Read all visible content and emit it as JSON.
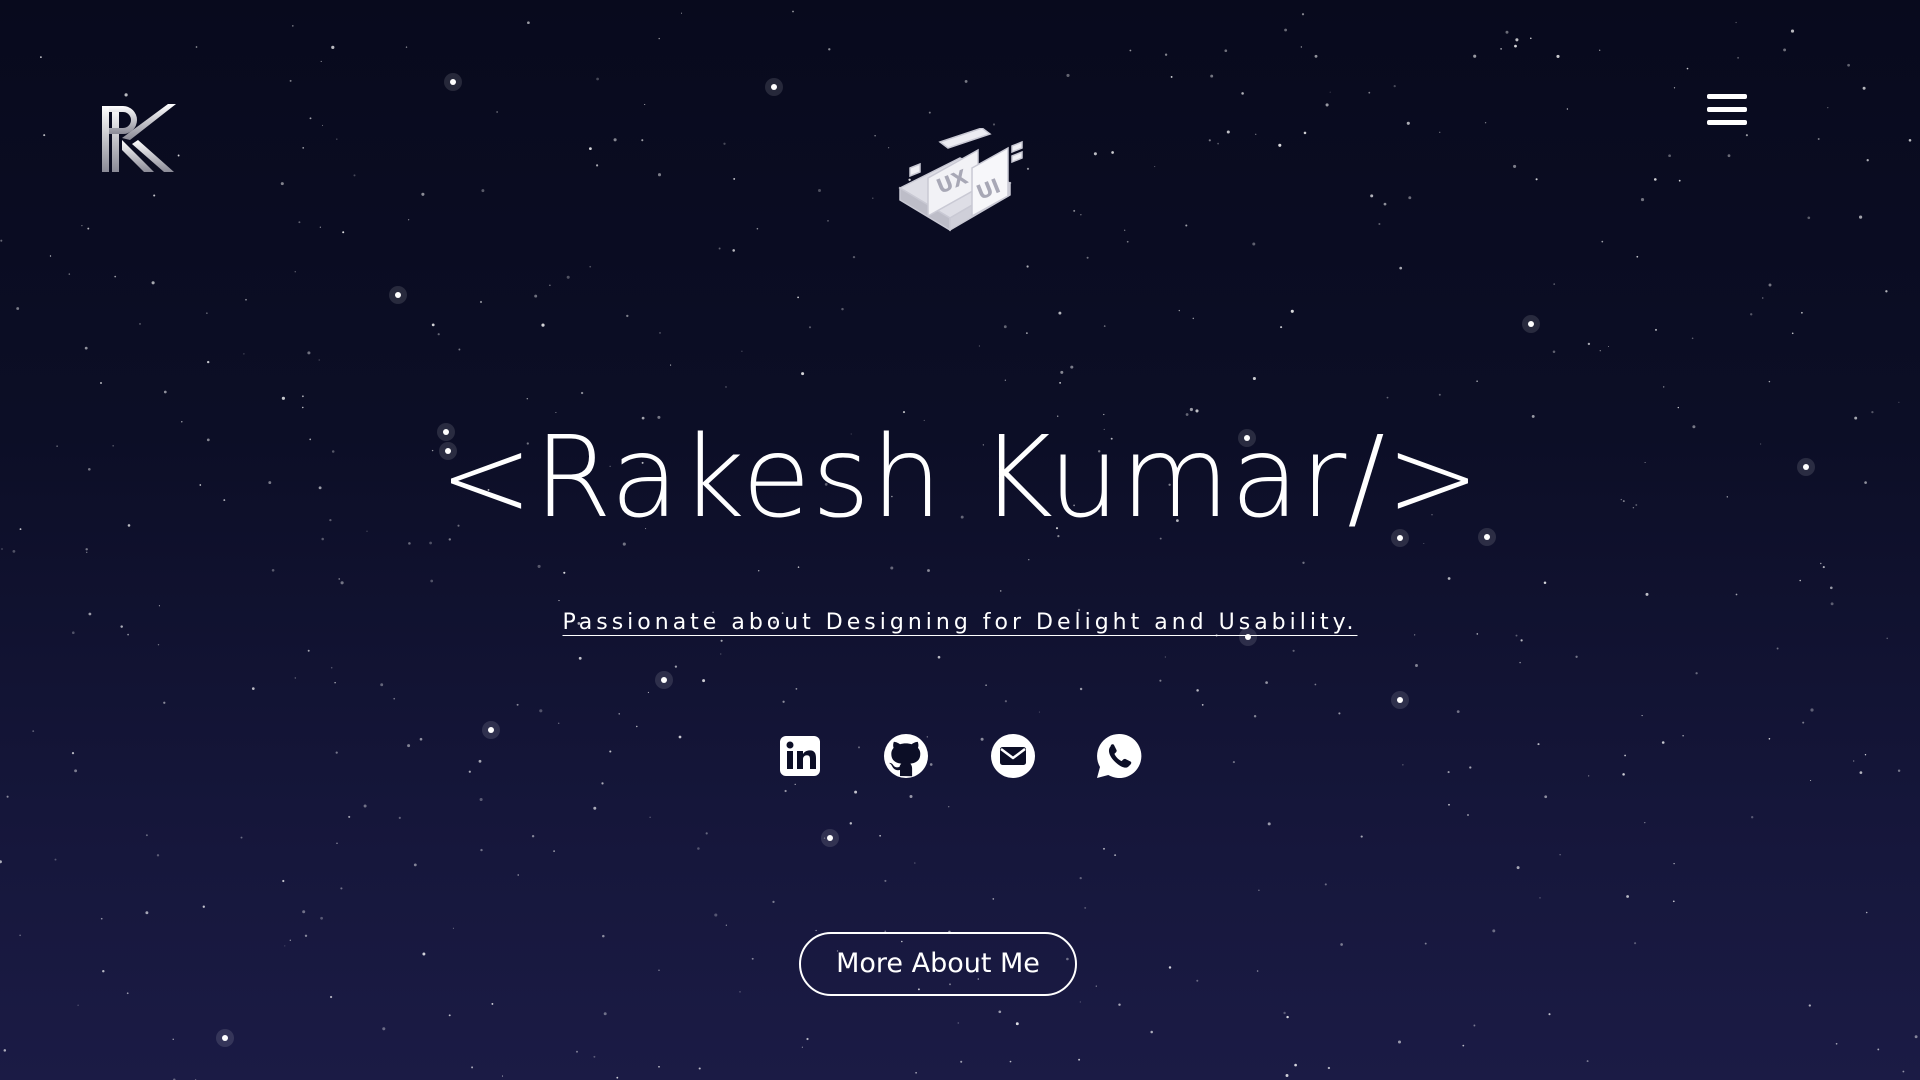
{
  "colors": {
    "background_top": "#080a1d",
    "background_bottom": "#1b1b45",
    "text": "#ffffff"
  },
  "header": {
    "logo_icon": "rk-monogram-logo",
    "menu_icon": "hamburger-menu-icon"
  },
  "hero": {
    "illustration_icon": "ux-ui-isometric-illustration",
    "title": "<Rakesh Kumar/>",
    "tagline": "Passionate about Designing for Delight and Usability."
  },
  "socials": [
    {
      "name": "linkedin",
      "icon": "linkedin-icon"
    },
    {
      "name": "github",
      "icon": "github-icon"
    },
    {
      "name": "email",
      "icon": "email-icon"
    },
    {
      "name": "whatsapp",
      "icon": "whatsapp-icon"
    }
  ],
  "cta": {
    "label": "More About Me"
  }
}
